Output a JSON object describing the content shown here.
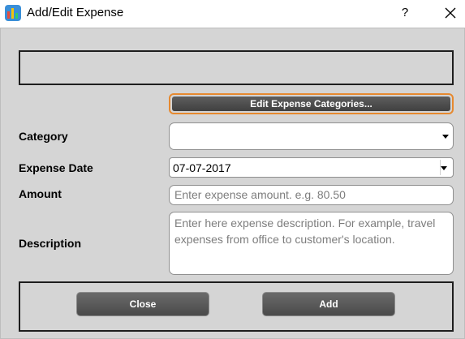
{
  "window": {
    "title": "Add/Edit Expense",
    "help_label": "?"
  },
  "form": {
    "edit_categories_button": "Edit Expense Categories...",
    "category": {
      "label": "Category",
      "value": ""
    },
    "expense_date": {
      "label": "Expense Date",
      "value": "07-07-2017"
    },
    "amount": {
      "label": "Amount",
      "value": "",
      "placeholder": "Enter expense amount. e.g. 80.50"
    },
    "description": {
      "label": "Description",
      "value": "",
      "placeholder": "Enter here expense description. For example, travel expenses from office to customer's location."
    }
  },
  "actions": {
    "close_label": "Close",
    "add_label": "Add"
  },
  "colors": {
    "background": "#d5d5d5",
    "button_dark": "#4a4a4a",
    "focus_accent": "#e6892f"
  }
}
